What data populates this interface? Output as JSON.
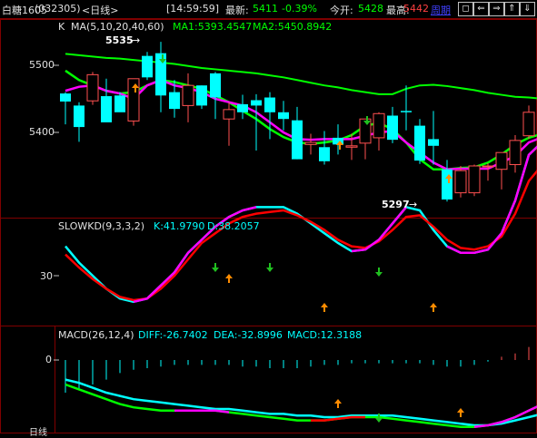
{
  "header": {
    "symbol": "白糖1605",
    "code": "(032305)",
    "period": "<日线>",
    "time": "[14:59:59]",
    "latest_label": "最新:",
    "latest_value": "5411",
    "change": "-0.39%",
    "open_label": "今开:",
    "open_value": "5428",
    "high_label": "最高:",
    "high_value": "5442",
    "period_link": "周期"
  },
  "window_buttons": [
    "◻",
    "⇐",
    "⇒",
    "⇑",
    "⇓"
  ],
  "kline_panel": {
    "k_label": "K",
    "ma_params": "MA(5,10,20,40,60)",
    "ma1": "MA1:5393.4547",
    "ma2": "MA2:5450.8942",
    "y_ticks": [
      "5500",
      "5400"
    ],
    "high_mark": "5535",
    "low_mark": "5297"
  },
  "kd_panel": {
    "name": "SLOWKD(9,3,3,2)",
    "k": "K:41.9790",
    "d": "D:38.2057",
    "y_tick": "30"
  },
  "macd_panel": {
    "name": "MACD(26,12,4)",
    "diff": "DIFF:-26.7402",
    "dea": "DEA:-32.8996",
    "macd": "MACD:12.3188",
    "y_tick": "0"
  },
  "footer_label": "日线",
  "colors": {
    "up": "#ff5050",
    "down": "#00ffff",
    "green_line": "#00ff00",
    "magenta_line": "#ff00ff",
    "red_line": "#ff0000",
    "frame": "#800000",
    "latest": "#00ff00",
    "high": "#ff4040",
    "link": "#4040ff"
  },
  "chart_data": {
    "candles": [
      [
        5458,
        5460,
        5412,
        5446
      ],
      [
        5440,
        5445,
        5386,
        5408
      ],
      [
        5447,
        5490,
        5441,
        5486
      ],
      [
        5454,
        5480,
        5420,
        5415
      ],
      [
        5455,
        5460,
        5441,
        5430
      ],
      [
        5417,
        5478,
        5410,
        5480
      ],
      [
        5514,
        5520,
        5478,
        5482
      ],
      [
        5518,
        5535,
        5430,
        5455
      ],
      [
        5460,
        5478,
        5422,
        5435
      ],
      [
        5440,
        5488,
        5415,
        5470
      ],
      [
        5470,
        5470,
        5435,
        5440
      ],
      [
        5488,
        5490,
        5420,
        5452
      ],
      [
        5420,
        5445,
        5380,
        5434
      ],
      [
        5442,
        5456,
        5420,
        5430
      ],
      [
        5448,
        5457,
        5373,
        5440
      ],
      [
        5452,
        5460,
        5390,
        5430
      ],
      [
        5430,
        5447,
        5403,
        5420
      ],
      [
        5418,
        5438,
        5360,
        5360
      ],
      [
        5382,
        5398,
        5367,
        5385
      ],
      [
        5378,
        5402,
        5352,
        5357
      ],
      [
        5392,
        5412,
        5367,
        5382
      ],
      [
        5378,
        5398,
        5359,
        5380
      ],
      [
        5384,
        5410,
        5360,
        5420
      ],
      [
        5392,
        5430,
        5373,
        5428
      ],
      [
        5425,
        5438,
        5384,
        5389
      ],
      [
        5432,
        5470,
        5403,
        5430
      ],
      [
        5410,
        5420,
        5353,
        5358
      ],
      [
        5390,
        5432,
        5352,
        5380
      ],
      [
        5345,
        5359,
        5297,
        5300
      ],
      [
        5310,
        5350,
        5303,
        5343
      ],
      [
        5310,
        5352,
        5305,
        5350
      ],
      [
        5349,
        5354,
        5328,
        5350
      ],
      [
        5345,
        5358,
        5315,
        5370
      ],
      [
        5352,
        5396,
        5340,
        5388
      ],
      [
        5395,
        5440,
        5390,
        5430
      ],
      [
        5428,
        5442,
        5408,
        5411
      ]
    ],
    "ma_long": [
      5517,
      5515,
      5513,
      5511,
      5510,
      5508,
      5506,
      5504,
      5502,
      5499,
      5496,
      5494,
      5492,
      5490,
      5488,
      5485,
      5482,
      5478,
      5474,
      5470,
      5467,
      5463,
      5460,
      5457,
      5457,
      5465,
      5470,
      5471,
      5469,
      5466,
      5463,
      5459,
      5456,
      5453,
      5452,
      5450
    ],
    "ma_green": [
      5492,
      5478,
      5470,
      5462,
      5458,
      5460,
      5470,
      5478,
      5475,
      5470,
      5465,
      5455,
      5445,
      5432,
      5420,
      5405,
      5393,
      5385,
      5383,
      5385,
      5388,
      5396,
      5410,
      5414,
      5405,
      5385,
      5360,
      5345,
      5345,
      5347,
      5348,
      5355,
      5367,
      5382,
      5392,
      5398
    ],
    "ma_magenta": [
      5462,
      5468,
      5470,
      5462,
      5458,
      5450,
      5470,
      5478,
      5470,
      5466,
      5460,
      5450,
      5445,
      5440,
      5430,
      5415,
      5400,
      5390,
      5389,
      5390,
      5390,
      5390,
      5395,
      5400,
      5402,
      5385,
      5370,
      5355,
      5345,
      5346,
      5346,
      5346,
      5355,
      5365,
      5385,
      5393
    ],
    "kd_k": [
      48,
      38,
      30,
      22,
      16,
      14,
      16,
      24,
      32,
      44,
      52,
      60,
      66,
      70,
      72,
      72,
      72,
      68,
      62,
      56,
      50,
      45,
      46,
      52,
      62,
      72,
      70,
      58,
      48,
      44,
      44,
      46,
      56,
      76,
      104,
      112
    ],
    "kd_d": [
      43,
      35,
      28,
      22,
      17,
      15,
      16,
      22,
      30,
      40,
      50,
      56,
      62,
      66,
      68,
      69,
      70,
      67,
      63,
      58,
      52,
      48,
      47,
      51,
      58,
      66,
      67,
      60,
      52,
      47,
      46,
      48,
      54,
      68,
      88,
      98
    ],
    "macd_diff": [
      -15,
      -18,
      -21,
      -24,
      -27,
      -29,
      -30,
      -31,
      -31,
      -31,
      -31,
      -31,
      -32,
      -33,
      -34,
      -35,
      -36,
      -37,
      -37,
      -37,
      -36,
      -35,
      -35,
      -35,
      -36,
      -37,
      -38,
      -39,
      -40,
      -41,
      -41,
      -40,
      -38,
      -35,
      -31,
      -27
    ],
    "macd_dea": [
      -12,
      -14,
      -17,
      -20,
      -22,
      -24,
      -25,
      -26,
      -27,
      -28,
      -29,
      -30,
      -30,
      -31,
      -32,
      -33,
      -33,
      -34,
      -34,
      -35,
      -35,
      -34,
      -34,
      -34,
      -34,
      -35,
      -36,
      -37,
      -38,
      -39,
      -40,
      -40,
      -39,
      -37,
      -35,
      -33
    ],
    "macd_bar": [
      -20,
      -18,
      -15,
      -12,
      -8,
      -6,
      -5,
      -4,
      -3,
      -3,
      -3,
      -3,
      -3,
      -4,
      -4,
      -5,
      -5,
      -5,
      -4,
      -3,
      -3,
      -2,
      -2,
      -2,
      -2,
      -2,
      -2,
      -3,
      -4,
      -4,
      -3,
      -1,
      2,
      4,
      8,
      12
    ]
  }
}
